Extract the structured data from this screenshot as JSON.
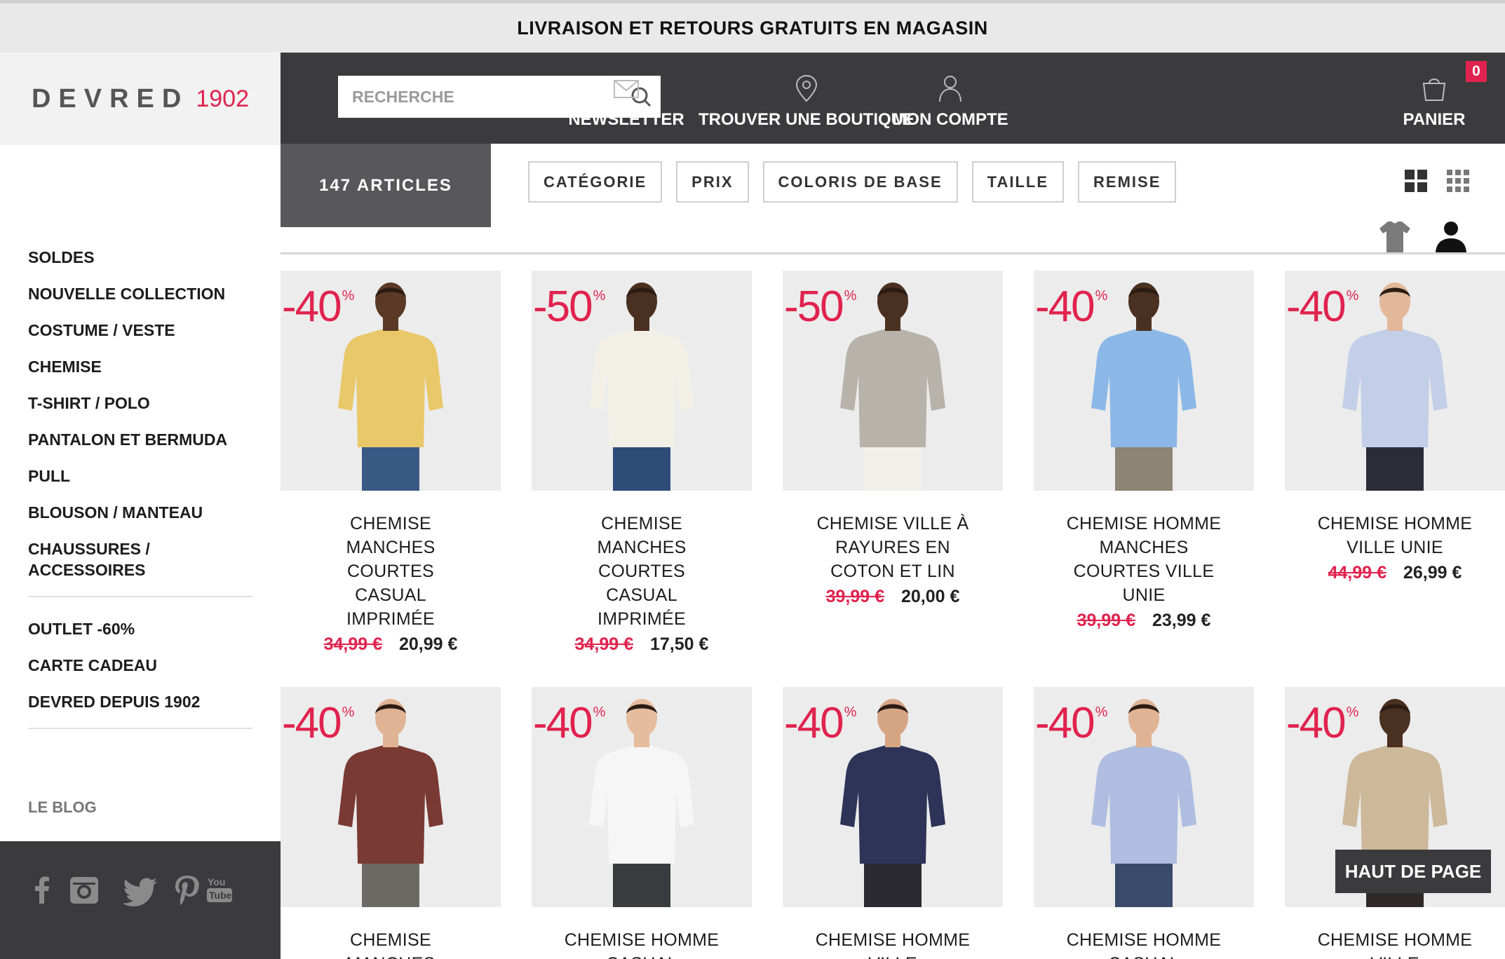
{
  "announcement": "LIVRAISON ET RETOURS GRATUITS EN MAGASIN",
  "brand": {
    "name": "DEVRED",
    "year": "1902",
    "accent": "#e0234e"
  },
  "header": {
    "search_placeholder": "RECHERCHE",
    "nav": [
      {
        "label": "NEWSLETTER",
        "icon": "envelope-icon"
      },
      {
        "label": "TROUVER UNE BOUTIQUE",
        "icon": "map-pin-icon"
      },
      {
        "label": "MON COMPTE",
        "icon": "user-icon"
      },
      {
        "label": "PANIER",
        "icon": "cart-icon",
        "badge": "0"
      }
    ]
  },
  "sidebar": {
    "menu": [
      "SOLDES",
      "NOUVELLE COLLECTION",
      "COSTUME / VESTE",
      "CHEMISE",
      "T-SHIRT / POLO",
      "PANTALON ET BERMUDA",
      "PULL",
      "BLOUSON / MANTEAU",
      "CHAUSSURES / ACCESSOIRES"
    ],
    "secondary": [
      "OUTLET -60%",
      "CARTE CADEAU",
      "DEVRED DEPUIS 1902"
    ],
    "blog": "LE BLOG",
    "social": [
      "facebook-icon",
      "instagram-icon",
      "twitter-icon",
      "pinterest-icon",
      "youtube-icon"
    ]
  },
  "filters": {
    "count_label": "147 ARTICLES",
    "buttons": [
      "CATÉGORIE",
      "PRIX",
      "COLORIS DE BASE",
      "TAILLE",
      "REMISE"
    ]
  },
  "products": [
    {
      "discount": "-40",
      "name": "CHEMISE MANCHES COURTES CASUAL IMPRIMÉE",
      "old_price": "34,99 €",
      "price": "20,99 €",
      "shirt": "#e9c86a",
      "pants": "#3a5a86",
      "skin": "#5a3a26"
    },
    {
      "discount": "-50",
      "name": "CHEMISE MANCHES COURTES CASUAL IMPRIMÉE",
      "old_price": "34,99 €",
      "price": "17,50 €",
      "shirt": "#f1efe6",
      "pants": "#2f4c78",
      "skin": "#4a3020"
    },
    {
      "discount": "-50",
      "name": "CHEMISE VILLE À RAYURES EN COTON ET LIN",
      "old_price": "39,99 €",
      "price": "20,00 €",
      "shirt": "#b8b3aa",
      "pants": "#f2f0ea",
      "skin": "#4a3020"
    },
    {
      "discount": "-40",
      "name": "CHEMISE HOMME MANCHES COURTES VILLE UNIE",
      "old_price": "39,99 €",
      "price": "23,99 €",
      "shirt": "#8cb8e8",
      "pants": "#8d8474",
      "skin": "#4a3020"
    },
    {
      "discount": "-40",
      "name": "CHEMISE HOMME VILLE UNIE",
      "old_price": "44,99 €",
      "price": "26,99 €",
      "shirt": "#c3cfe8",
      "pants": "#2a2d38",
      "skin": "#e3b89a"
    },
    {
      "discount": "-40",
      "name": "CHEMISE MANCHES",
      "old_price": "",
      "price": "",
      "shirt": "#7a3a34",
      "pants": "#6d6a66",
      "skin": "#e0b394"
    },
    {
      "discount": "-40",
      "name": "CHEMISE HOMME CASUAL",
      "old_price": "",
      "price": "",
      "shirt": "#f6f6f6",
      "pants": "#3a3b3f",
      "skin": "#e6bc9e"
    },
    {
      "discount": "-40",
      "name": "CHEMISE HOMME VILLE",
      "old_price": "",
      "price": "",
      "shirt": "#2d3458",
      "pants": "#2a2a30",
      "skin": "#d6a584"
    },
    {
      "discount": "-40",
      "name": "CHEMISE HOMME CASUAL",
      "old_price": "",
      "price": "",
      "shirt": "#aebde0",
      "pants": "#3a4a6a",
      "skin": "#e0b394"
    },
    {
      "discount": "-40",
      "name": "CHEMISE HOMME VILLE",
      "old_price": "",
      "price": "",
      "shirt": "#cdb89a",
      "pants": "#2f2a28",
      "skin": "#4a3020"
    }
  ],
  "back_to_top": "HAUT DE PAGE"
}
